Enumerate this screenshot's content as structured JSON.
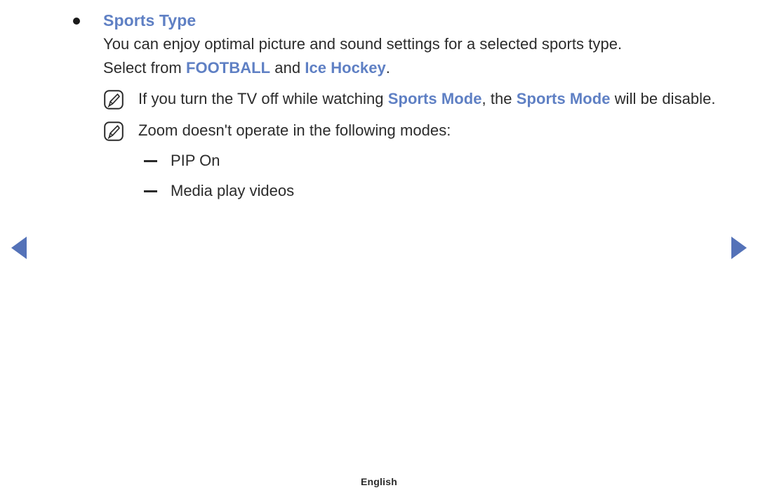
{
  "page": {
    "background_color": "#ffffff",
    "accent_color": "#5f80c4",
    "text_color": "#2b2b2b",
    "arrow_color": "#5472b8"
  },
  "section": {
    "bullet_icon": "filled-circle-bullet",
    "heading": "Sports Type",
    "paragraph": {
      "line1": "You can enjoy optimal picture and sound settings for a selected sports type.",
      "line2_prefix": "Select from ",
      "line2_highlight_1": "FOOTBALL",
      "line2_middle": " and ",
      "line2_highlight_2": "Ice Hockey",
      "line2_suffix": "."
    }
  },
  "notes": [
    {
      "icon": "note-pen-icon",
      "prefix": "If you turn the TV off while watching ",
      "highlight_1": "Sports Mode",
      "middle": ", the ",
      "highlight_2": "Sports Mode",
      "suffix": " will be disable."
    },
    {
      "icon": "note-pen-icon",
      "text": "Zoom doesn't operate in the following modes:"
    }
  ],
  "sub_items": [
    {
      "dash": "en-dash",
      "label": "PIP On"
    },
    {
      "dash": "en-dash",
      "label": "Media play videos"
    }
  ],
  "navigation": {
    "prev_icon": "triangle-left-icon",
    "next_icon": "triangle-right-icon"
  },
  "footer": {
    "language": "English"
  }
}
